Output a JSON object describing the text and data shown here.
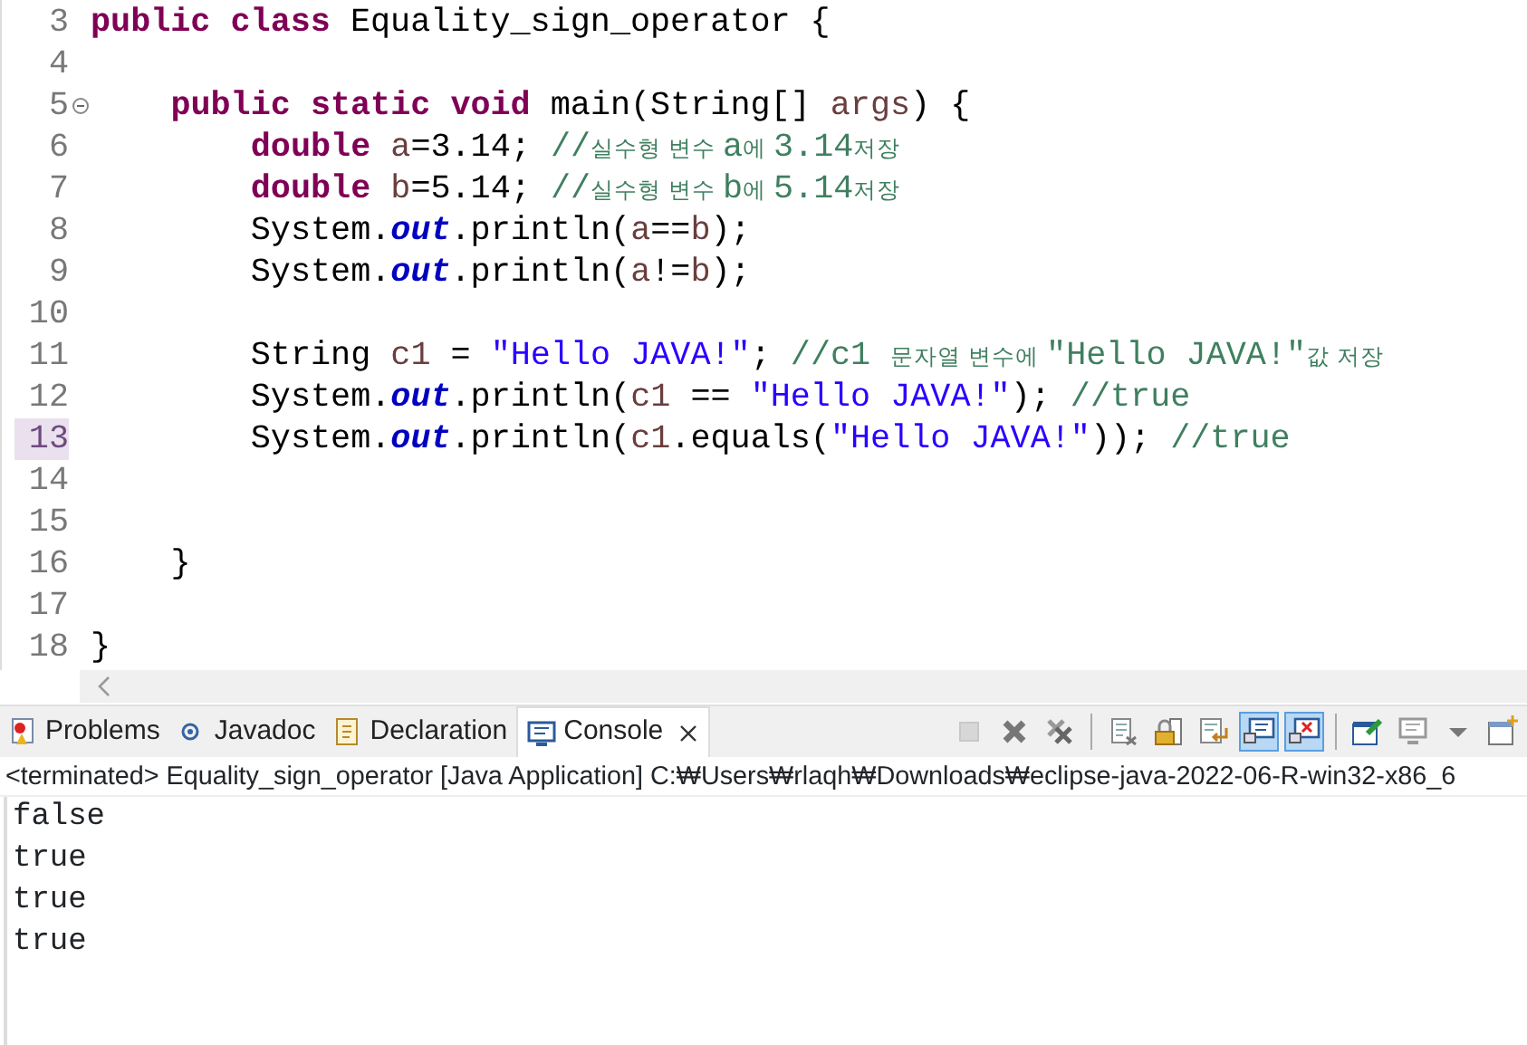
{
  "editor": {
    "lines": [
      {
        "number": "3",
        "kind": "top",
        "current": false,
        "foldable": false,
        "tokens": [
          {
            "kind": "kw",
            "text": "public class"
          },
          {
            "kind": "plain",
            "text": " Equality_sign_operator {"
          }
        ]
      },
      {
        "number": "4",
        "current": false,
        "foldable": false
      },
      {
        "number": "5",
        "kind": "member",
        "current": false,
        "foldable": true,
        "tokens": [
          {
            "kind": "kw",
            "text": "public static void"
          },
          {
            "kind": "plain",
            "text": " main(String[] "
          },
          {
            "kind": "var",
            "text": "args"
          },
          {
            "kind": "plain",
            "text": ") {"
          }
        ]
      },
      {
        "number": "6",
        "kind": "statement",
        "current": false,
        "foldable": false,
        "tokens": [
          {
            "kind": "kw",
            "text": "double "
          },
          {
            "kind": "var",
            "text": "a"
          },
          {
            "kind": "plain",
            "text": "=3.14; "
          },
          {
            "kind": "cm",
            "text": "//"
          },
          {
            "kind": "cmk",
            "text": "실수형 변수 "
          },
          {
            "kind": "cm",
            "text": "a"
          },
          {
            "kind": "cmk",
            "text": "에 "
          },
          {
            "kind": "cm",
            "text": "3.14"
          },
          {
            "kind": "cmk",
            "text": "저장"
          }
        ]
      },
      {
        "number": "7",
        "kind": "statement",
        "current": false,
        "foldable": false,
        "tokens": [
          {
            "kind": "kw",
            "text": "double "
          },
          {
            "kind": "var",
            "text": "b"
          },
          {
            "kind": "plain",
            "text": "=5.14; "
          },
          {
            "kind": "cm",
            "text": "//"
          },
          {
            "kind": "cmk",
            "text": "실수형 변수 "
          },
          {
            "kind": "cm",
            "text": "b"
          },
          {
            "kind": "cmk",
            "text": "에 "
          },
          {
            "kind": "cm",
            "text": "5.14"
          },
          {
            "kind": "cmk",
            "text": "저장"
          }
        ]
      },
      {
        "number": "8",
        "kind": "statement",
        "current": false,
        "foldable": false,
        "tokens": [
          {
            "kind": "plain",
            "text": "System."
          },
          {
            "kind": "field",
            "text": "out"
          },
          {
            "kind": "plain",
            "text": ".println("
          },
          {
            "kind": "var",
            "text": "a"
          },
          {
            "kind": "plain",
            "text": "=="
          },
          {
            "kind": "var",
            "text": "b"
          },
          {
            "kind": "plain",
            "text": ");"
          }
        ]
      },
      {
        "number": "9",
        "kind": "statement",
        "current": false,
        "foldable": false,
        "tokens": [
          {
            "kind": "plain",
            "text": "System."
          },
          {
            "kind": "field",
            "text": "out"
          },
          {
            "kind": "plain",
            "text": ".println("
          },
          {
            "kind": "var",
            "text": "a"
          },
          {
            "kind": "plain",
            "text": "!="
          },
          {
            "kind": "var",
            "text": "b"
          },
          {
            "kind": "plain",
            "text": ");"
          }
        ]
      },
      {
        "number": "10",
        "current": false,
        "foldable": false
      },
      {
        "number": "11",
        "kind": "statement",
        "current": false,
        "foldable": false,
        "tokens": [
          {
            "kind": "plain",
            "text": "String "
          },
          {
            "kind": "var",
            "text": "c1"
          },
          {
            "kind": "plain",
            "text": " = "
          },
          {
            "kind": "str",
            "text": "\"Hello JAVA!\""
          },
          {
            "kind": "plain",
            "text": "; "
          },
          {
            "kind": "cm",
            "text": "//c1 "
          },
          {
            "kind": "cmk",
            "text": "문자열 변수에 "
          },
          {
            "kind": "cm",
            "text": "\"Hello JAVA!\""
          },
          {
            "kind": "cmk",
            "text": "값 저장"
          }
        ]
      },
      {
        "number": "12",
        "kind": "statement",
        "current": false,
        "foldable": false,
        "tokens": [
          {
            "kind": "plain",
            "text": "System."
          },
          {
            "kind": "field",
            "text": "out"
          },
          {
            "kind": "plain",
            "text": ".println("
          },
          {
            "kind": "var",
            "text": "c1"
          },
          {
            "kind": "plain",
            "text": " == "
          },
          {
            "kind": "str",
            "text": "\"Hello JAVA!\""
          },
          {
            "kind": "plain",
            "text": "); "
          },
          {
            "kind": "cm",
            "text": "//true"
          }
        ]
      },
      {
        "number": "13",
        "kind": "statement",
        "current": true,
        "foldable": false,
        "tokens": [
          {
            "kind": "plain",
            "text": "System."
          },
          {
            "kind": "field",
            "text": "out"
          },
          {
            "kind": "plain",
            "text": ".println("
          },
          {
            "kind": "var",
            "text": "c1"
          },
          {
            "kind": "plain",
            "text": ".equals("
          },
          {
            "kind": "str",
            "text": "\"Hello JAVA!\""
          },
          {
            "kind": "plain",
            "text": ")); "
          },
          {
            "kind": "cm",
            "text": "//true"
          }
        ]
      },
      {
        "number": "14",
        "current": false,
        "foldable": false
      },
      {
        "number": "15",
        "current": false,
        "foldable": false
      },
      {
        "number": "16",
        "kind": "member",
        "current": false,
        "foldable": false,
        "tokens": [
          {
            "kind": "plain",
            "text": "}"
          }
        ]
      },
      {
        "number": "17",
        "current": false,
        "foldable": false
      },
      {
        "number": "18",
        "kind": "top",
        "current": false,
        "foldable": false,
        "tokens": [
          {
            "kind": "plain",
            "text": "}"
          }
        ]
      }
    ]
  },
  "panel": {
    "tabs": [
      {
        "label": "Problems",
        "selected": false,
        "closable": false
      },
      {
        "label": "Javadoc",
        "selected": false,
        "closable": false
      },
      {
        "label": "Declaration",
        "selected": false,
        "closable": false
      },
      {
        "label": "Console",
        "selected": true,
        "closable": true
      }
    ],
    "toolbar": [
      {
        "kind": "terminate",
        "pressed": false,
        "disabled": true
      },
      {
        "kind": "remove",
        "pressed": false,
        "disabled": false
      },
      {
        "kind": "remove-all",
        "pressed": false,
        "disabled": false
      },
      {
        "kind": "separator"
      },
      {
        "kind": "clear",
        "pressed": false,
        "disabled": false
      },
      {
        "kind": "scroll-lock",
        "pressed": false,
        "disabled": false
      },
      {
        "kind": "word-wrap",
        "pressed": false,
        "disabled": false
      },
      {
        "kind": "show-out",
        "pressed": true,
        "disabled": false
      },
      {
        "kind": "show-err",
        "pressed": true,
        "disabled": false
      },
      {
        "kind": "separator"
      },
      {
        "kind": "pin",
        "pressed": false,
        "disabled": false
      },
      {
        "kind": "display",
        "pressed": false,
        "disabled": false
      },
      {
        "kind": "dropdown",
        "pressed": false,
        "disabled": false
      },
      {
        "kind": "new-window",
        "pressed": false,
        "disabled": false
      }
    ],
    "console": {
      "header": "<terminated> Equality_sign_operator [Java Application] C:₩Users₩rlaqh₩Downloads₩eclipse-java-2022-06-R-win32-x86_6",
      "output": [
        "false",
        "true",
        "true",
        "true"
      ]
    }
  }
}
